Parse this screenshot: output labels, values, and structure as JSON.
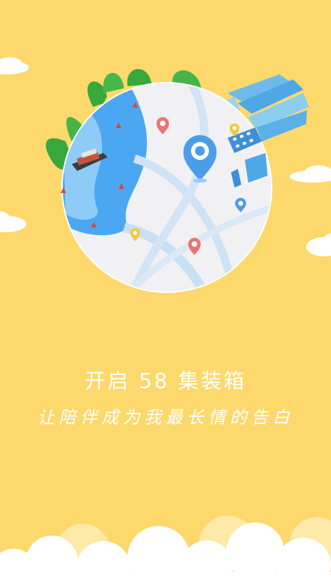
{
  "splash": {
    "title": "开启 58 集装箱",
    "subtitle": "让陪伴成为我最长情的告白"
  },
  "colors": {
    "background": "#FDD86C",
    "sea": "#4BA7F2",
    "shallow_water": "#8FCBF7",
    "map_land": "#F1F1F3",
    "greenery": "#38A83C",
    "city": "#5EB4EA",
    "pin_red": "#EE7373",
    "pin_yellow": "#F5C844",
    "pin_blue": "#4C9DE8",
    "text": "#FFFFFF"
  },
  "icons": [
    "cloud-icon",
    "map-pin-icon",
    "ship-icon",
    "buoy-icon",
    "building-icon",
    "crane-icon"
  ]
}
